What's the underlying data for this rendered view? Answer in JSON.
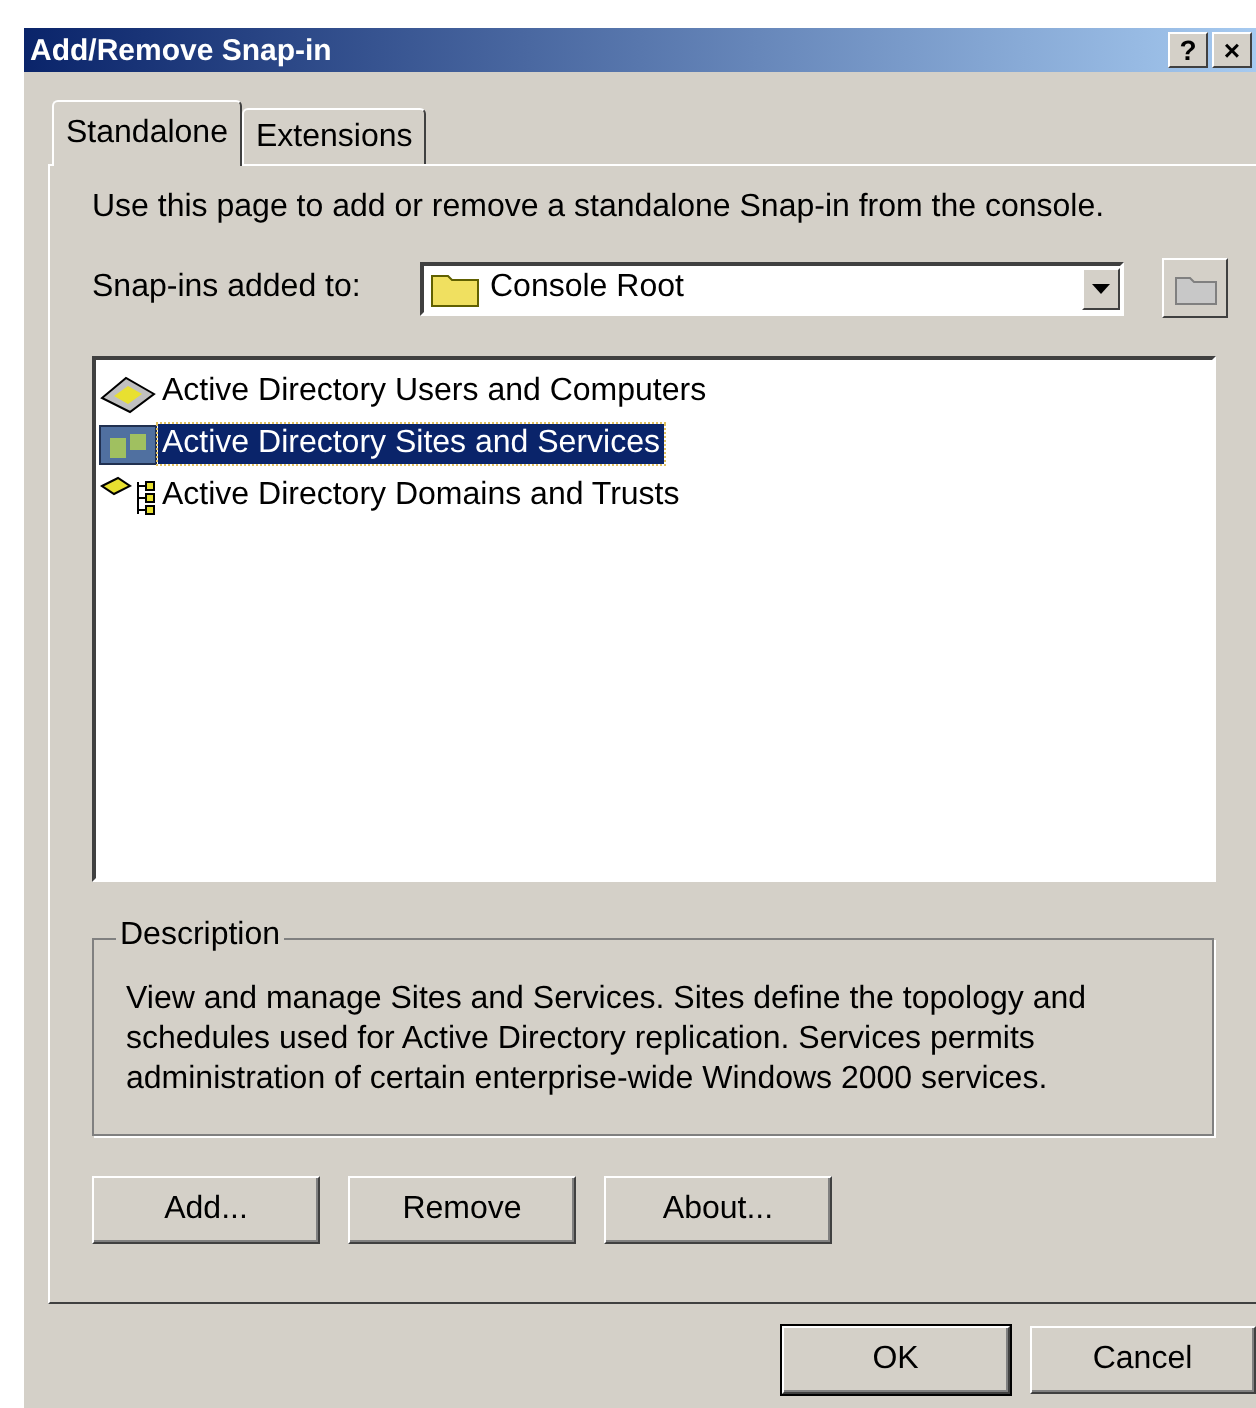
{
  "window": {
    "title": "Add/Remove Snap-in",
    "title_buttons": [
      "?",
      "×"
    ]
  },
  "tabs": [
    {
      "label": "Standalone",
      "selected": true
    },
    {
      "label": "Extensions",
      "selected": false
    }
  ],
  "intro": "Use this page to add or remove a standalone Snap-in from the console.",
  "snapins_added_to": {
    "label": "Snap-ins added to:",
    "value": "Console Root"
  },
  "snapins": [
    {
      "name": "Active Directory Users and Computers",
      "kind": "users",
      "selected": false
    },
    {
      "name": "Active Directory Sites and Services",
      "kind": "sites",
      "selected": true
    },
    {
      "name": "Active Directory Domains and Trusts",
      "kind": "domains",
      "selected": false
    }
  ],
  "description": {
    "title": "Description",
    "text": "View and manage Sites and Services. Sites define the topology and schedules used for Active Directory replication. Services permits administration of certain enterprise-wide Windows 2000 services."
  },
  "panel_buttons": [
    "Add...",
    "Remove",
    "About..."
  ],
  "dialog_buttons": [
    "OK",
    "Cancel"
  ]
}
